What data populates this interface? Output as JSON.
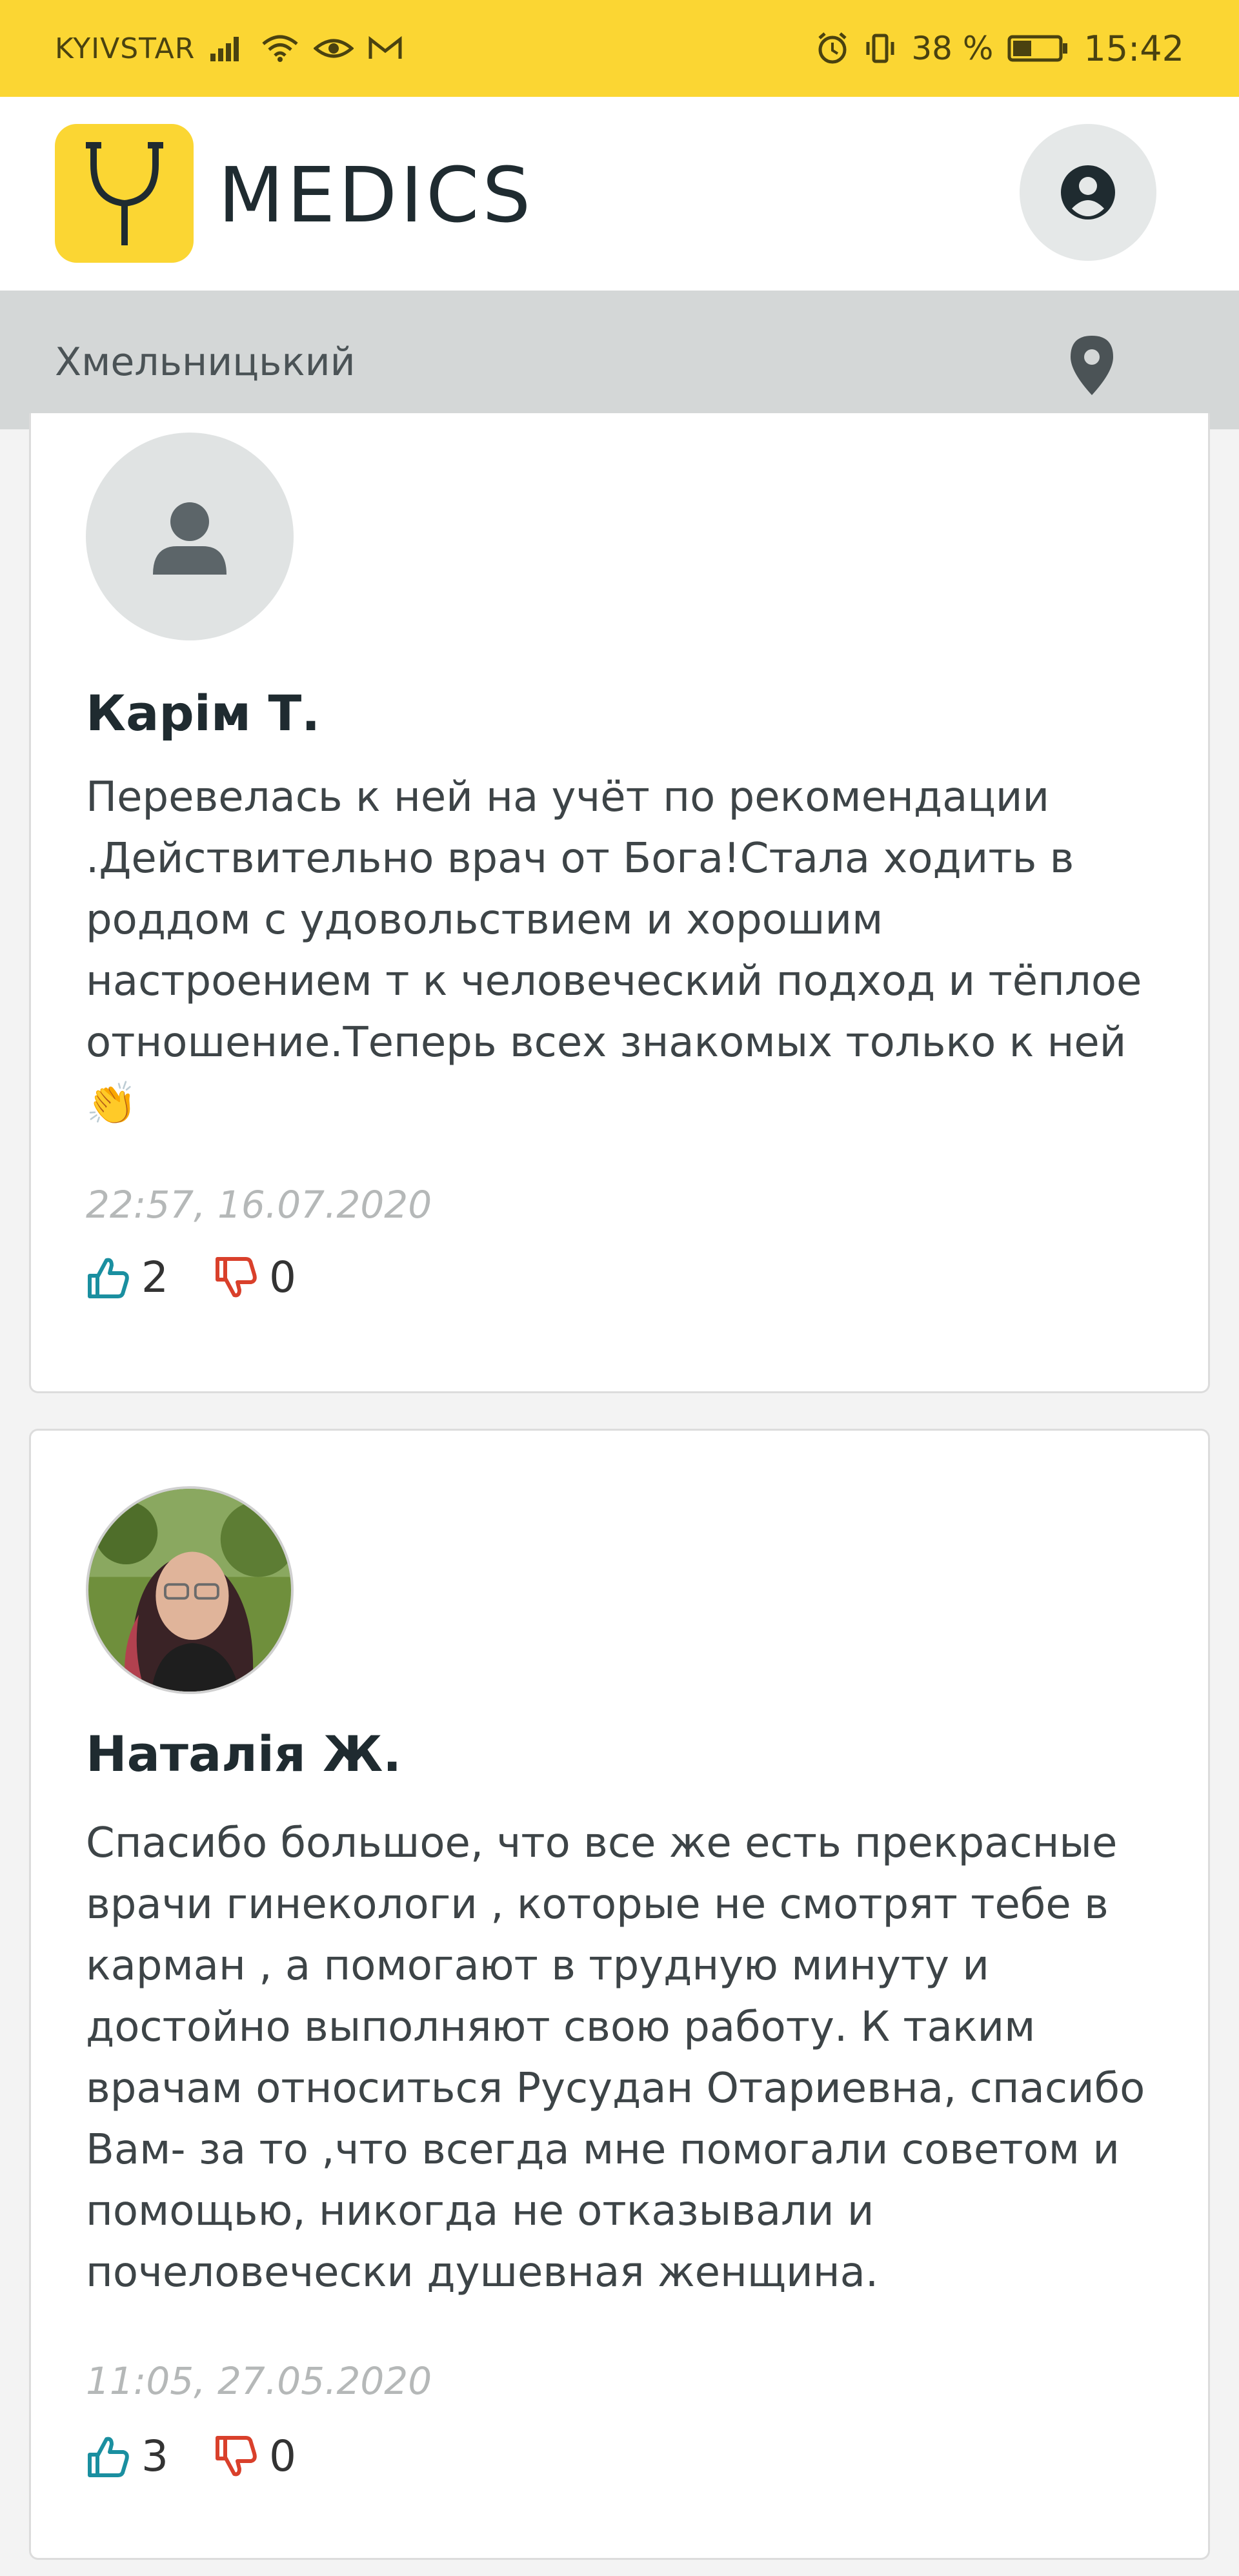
{
  "status_bar": {
    "carrier": "KYIVSTAR",
    "battery_percent": "38 %",
    "time": "15:42",
    "icons": [
      "signal-icon",
      "wifi-icon",
      "eye-icon",
      "mail-icon",
      "alarm-icon",
      "vibrate-icon",
      "battery-icon"
    ]
  },
  "header": {
    "brand": "MEDICS",
    "logo_icon": "stethoscope-icon",
    "profile_icon": "user-circle-icon"
  },
  "location": {
    "city": "Хмельницький",
    "icon": "location-pin-icon"
  },
  "reviews": [
    {
      "name": "Карім Т.",
      "avatar": "default-avatar",
      "text": "Перевелась к ней на учёт по рекомендации\n.Действительно врач от Бога!Стала ходить в\nроддом с удовольствием и хорошим\nнастроением т к человеческий подход и тёплое\nотношение.Теперь всех знакомых только к ней\n👏",
      "date": "22:57, 16.07.2020",
      "likes": "2",
      "dislikes": "0"
    },
    {
      "name": "Наталія Ж.",
      "avatar": "photo-avatar",
      "text": "Спасибо большое, что все же есть прекрасные\nврачи гинекологи , которые не смотрят тебе в\nкарман , а помогают в трудную минуту и\nдостойно выполняют свою работу. К таким\nврачам относиться Русудан Отариевна, спасибо\nВам- за то ,что всегда мне помогали советом и\nпомощью, никогда не отказывали и\nпочеловечески душевная женщина.",
      "date": "11:05, 27.05.2020",
      "likes": "3",
      "dislikes": "0"
    }
  ],
  "colors": {
    "brand_yellow": "#fbd633",
    "like": "#1a8fa0",
    "dislike": "#d9402b"
  }
}
